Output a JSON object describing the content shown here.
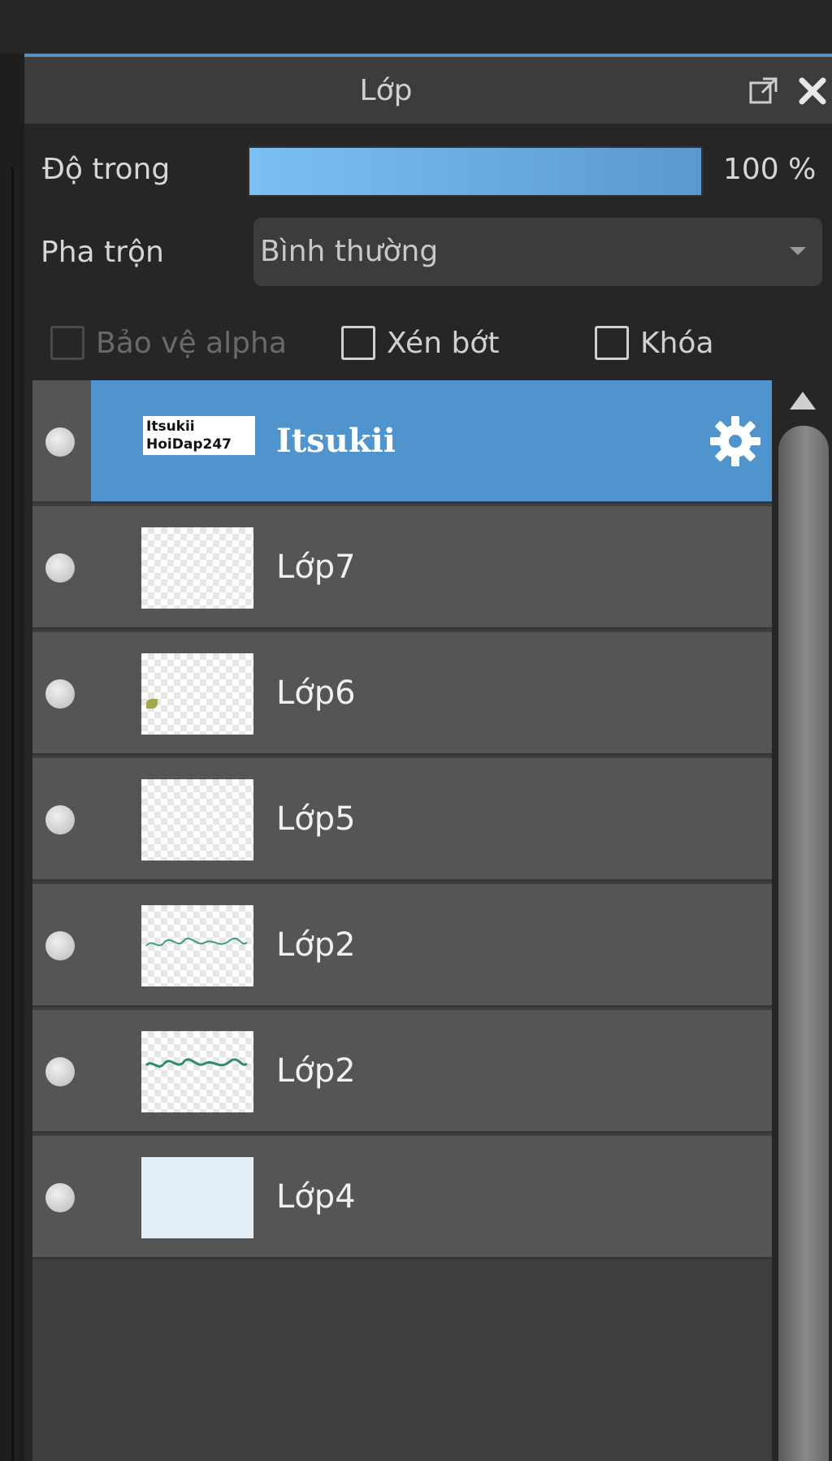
{
  "panel": {
    "title": "Lớp",
    "popout_icon": "popout-icon",
    "close_icon": "close-icon"
  },
  "opacity": {
    "label": "Độ trong",
    "value_text": "100 %",
    "value": 100
  },
  "blend": {
    "label": "Pha trộn",
    "selected": "Bình thường"
  },
  "options": {
    "protect_alpha": {
      "label": "Bảo vệ alpha",
      "checked": false,
      "enabled": false
    },
    "clipping": {
      "label": "Xén bớt",
      "checked": false,
      "enabled": true
    },
    "lock": {
      "label": "Khóa",
      "checked": false,
      "enabled": true
    }
  },
  "layers": [
    {
      "name": "Itsukii",
      "selected": true,
      "thumb_text": [
        "Itsukii",
        "HoiDap247"
      ]
    },
    {
      "name": "Lớp7"
    },
    {
      "name": "Lớp6"
    },
    {
      "name": "Lớp5"
    },
    {
      "name": "Lớp2"
    },
    {
      "name": "Lớp2"
    },
    {
      "name": "Lớp4"
    }
  ],
  "colors": {
    "accent": "#4f94cc",
    "opacity_fill": "#7ac0f3",
    "layer_bg": "#555555",
    "panel_bg": "#262626"
  }
}
